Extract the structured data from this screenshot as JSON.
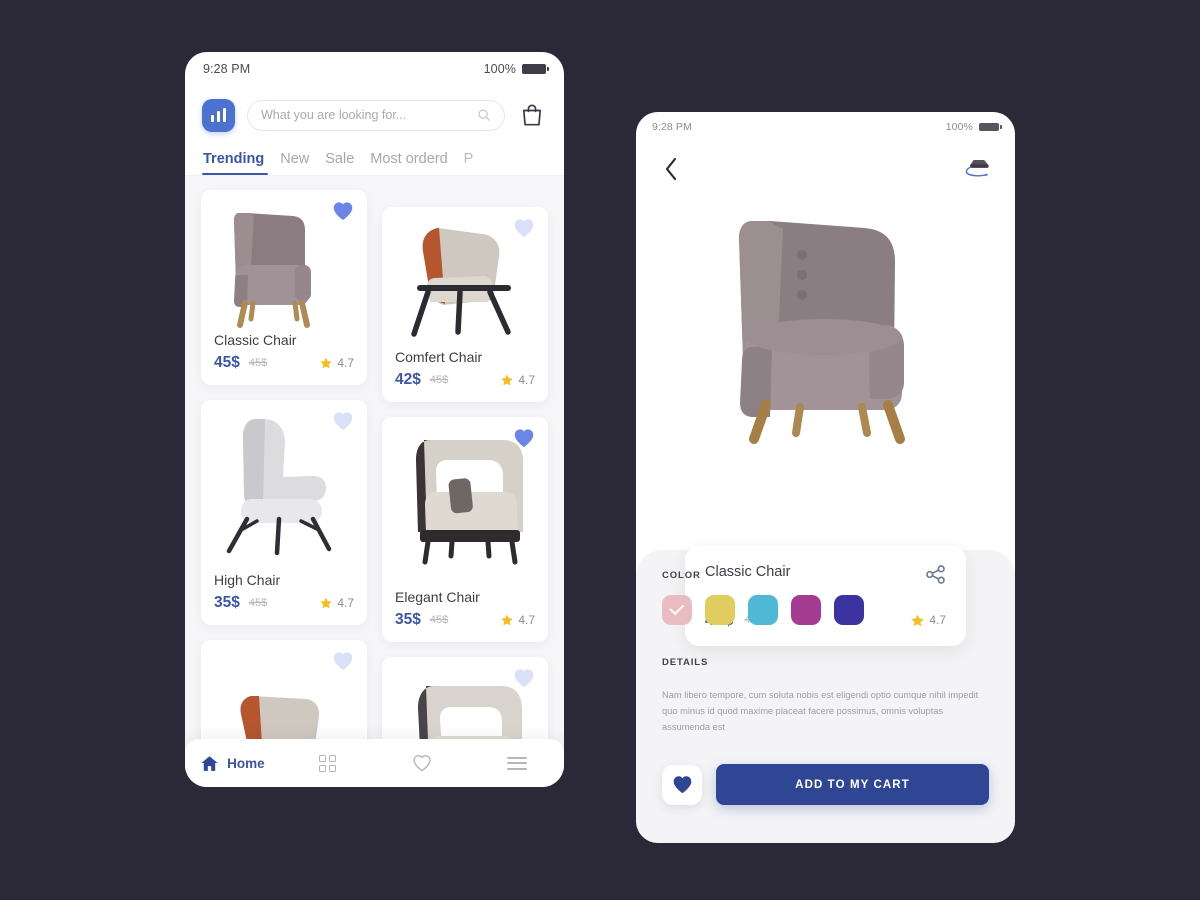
{
  "theme": {
    "page_bg": "#2b2838",
    "accent_blue": "#3b55a8",
    "logo_blue": "#4b72d1",
    "cta_navy": "#2f4694",
    "star_gold": "#f5bd1f",
    "heart_active": "#6b86e8",
    "heart_inactive": "#d9e0f7",
    "panel_grey": "#f4f4f6",
    "grid_bg": "#f6f6f8"
  },
  "listing_screen": {
    "status_bar": {
      "time": "9:28 PM",
      "battery_percent": "100%",
      "battery_icon": "battery-full-icon"
    },
    "header": {
      "logo_icon": "bar-chart-logo-icon",
      "search_placeholder": "What you are looking for...",
      "search_value": "",
      "search_icon": "search-icon",
      "cart_icon": "shopping-bag-icon"
    },
    "tabs": [
      {
        "label": "Trending",
        "active": true
      },
      {
        "label": "New",
        "active": false
      },
      {
        "label": "Sale",
        "active": false
      },
      {
        "label": "Most orderd",
        "active": false
      },
      {
        "label": "P",
        "active": false,
        "clipped": true
      }
    ],
    "products": [
      {
        "name": "Classic Chair",
        "price": "45$",
        "price_old": "45$",
        "rating": "4.7",
        "favorited": true,
        "column": "left",
        "chair_style": "classic-armchair"
      },
      {
        "name": "Comfert Chair",
        "price": "42$",
        "price_old": "45$",
        "rating": "4.7",
        "favorited": false,
        "column": "right",
        "chair_style": "lounge-chair"
      },
      {
        "name": "High Chair",
        "price": "35$",
        "price_old": "45$",
        "rating": "4.7",
        "favorited": false,
        "column": "left",
        "chair_style": "high-back-chair"
      },
      {
        "name": "Elegant Chair",
        "price": "35$",
        "price_old": "45$",
        "rating": "4.7",
        "favorited": true,
        "column": "right",
        "chair_style": "wingback-chair"
      }
    ],
    "partial_products": [
      {
        "favorited": false,
        "column": "left",
        "chair_style": "lounge-chair"
      },
      {
        "favorited": false,
        "column": "right",
        "chair_style": "wingback-chair"
      }
    ],
    "bottom_nav": [
      {
        "label": "Home",
        "icon": "home-icon",
        "active": true
      },
      {
        "label": "",
        "icon": "grid-icon",
        "active": false
      },
      {
        "label": "",
        "icon": "heart-outline-icon",
        "active": false
      },
      {
        "label": "",
        "icon": "menu-icon",
        "active": false
      }
    ]
  },
  "detail_screen": {
    "status_bar": {
      "time": "9:28 PM",
      "battery_percent": "100%",
      "battery_icon": "battery-full-icon"
    },
    "header": {
      "back_icon": "chevron-left-icon",
      "view_3d_icon": "rotate-360-view-icon"
    },
    "hero_image": "classic-armchair-large",
    "product": {
      "name": "Classic Chair",
      "price": "42$",
      "price_old": "45$",
      "rating": "4.7",
      "share_icon": "share-icon",
      "star_icon": "star-icon"
    },
    "color_section": {
      "label": "COLOR",
      "swatches": [
        {
          "hex": "#e9bcc1",
          "name": "dusty-pink",
          "selected": true
        },
        {
          "hex": "#e0cc5f",
          "name": "gold",
          "selected": false
        },
        {
          "hex": "#4fb8d4",
          "name": "sky-blue",
          "selected": false
        },
        {
          "hex": "#a43d91",
          "name": "magenta",
          "selected": false
        },
        {
          "hex": "#3b33a0",
          "name": "indigo",
          "selected": false
        }
      ]
    },
    "details_section": {
      "label": "DETAILS",
      "body": "Nam libero tempore, cum soluta nobis est eligendi optio cumque nihil impedit quo minus id quod maxime placeat facere possimus, omnis voluptas assumenda est"
    },
    "actions": {
      "favorite_icon": "heart-filled-icon",
      "add_to_cart_label": "ADD TO MY CART"
    }
  }
}
